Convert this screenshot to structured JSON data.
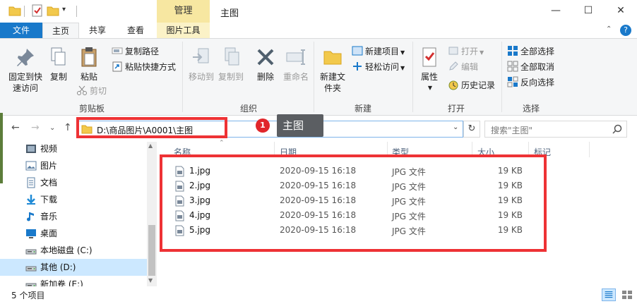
{
  "titlebar": {
    "manage_tab": "管理",
    "title": "主图",
    "minimize_glyph": "—",
    "maximize_glyph": "☐",
    "close_glyph": "✕",
    "dropdown_glyph": "▾"
  },
  "tabs": {
    "file": "文件",
    "home": "主页",
    "share": "共享",
    "view": "查看",
    "picture_tools": "图片工具",
    "collapse_glyph": "⌃",
    "help_glyph": "?"
  },
  "ribbon": {
    "clipboard": {
      "label": "剪贴板",
      "pin": "固定到快速访问",
      "copy": "复制",
      "paste": "粘贴",
      "copy_path": "复制路径",
      "paste_shortcut": "粘贴快捷方式",
      "cut": "剪切"
    },
    "organize": {
      "label": "组织",
      "move_to": "移动到",
      "copy_to": "复制到",
      "delete": "删除",
      "rename": "重命名"
    },
    "new": {
      "label": "新建",
      "new_folder": "新建文件夹",
      "new_item": "新建项目",
      "easy_access": "轻松访问"
    },
    "open": {
      "label": "打开",
      "properties": "属性",
      "open": "打开",
      "edit": "编辑",
      "history": "历史记录"
    },
    "select": {
      "label": "选择",
      "select_all": "全部选择",
      "select_none": "全部取消",
      "invert": "反向选择"
    }
  },
  "address": {
    "path": "D:\\商品图片\\A0001\\主图",
    "search_placeholder": "搜索\"主图\"",
    "back_glyph": "←",
    "forward_glyph": "→",
    "up_glyph": "↑",
    "dropdown_glyph": "⌄",
    "recent_glyph": "⌄",
    "refresh_glyph": "↻"
  },
  "annotation": {
    "badge": "1",
    "tooltip": "主图"
  },
  "nav": {
    "items": [
      {
        "label": "视频",
        "icon": "video-icon"
      },
      {
        "label": "图片",
        "icon": "pictures-icon"
      },
      {
        "label": "文档",
        "icon": "documents-icon"
      },
      {
        "label": "下载",
        "icon": "downloads-icon"
      },
      {
        "label": "音乐",
        "icon": "music-icon"
      },
      {
        "label": "桌面",
        "icon": "desktop-icon"
      },
      {
        "label": "本地磁盘 (C:)",
        "icon": "drive-icon"
      },
      {
        "label": "其他 (D:)",
        "icon": "drive-icon"
      },
      {
        "label": "新加卷 (E:)",
        "icon": "drive-icon"
      }
    ],
    "selected_index": 7
  },
  "columns": {
    "name": "名称",
    "date": "日期",
    "type": "类型",
    "size": "大小",
    "tags": "标记"
  },
  "files": [
    {
      "name": "1.jpg",
      "date": "2020-09-15 16:18",
      "type": "JPG 文件",
      "size": "19 KB"
    },
    {
      "name": "2.jpg",
      "date": "2020-09-15 16:18",
      "type": "JPG 文件",
      "size": "19 KB"
    },
    {
      "name": "3.jpg",
      "date": "2020-09-15 16:18",
      "type": "JPG 文件",
      "size": "19 KB"
    },
    {
      "name": "4.jpg",
      "date": "2020-09-15 16:18",
      "type": "JPG 文件",
      "size": "19 KB"
    },
    {
      "name": "5.jpg",
      "date": "2020-09-15 16:18",
      "type": "JPG 文件",
      "size": "19 KB"
    }
  ],
  "status": {
    "count": "5 个项目"
  },
  "colors": {
    "accent": "#1979ca",
    "annotation_red": "#ee3235",
    "manage_tab": "#f7e7a1",
    "selection": "#cce8ff"
  }
}
